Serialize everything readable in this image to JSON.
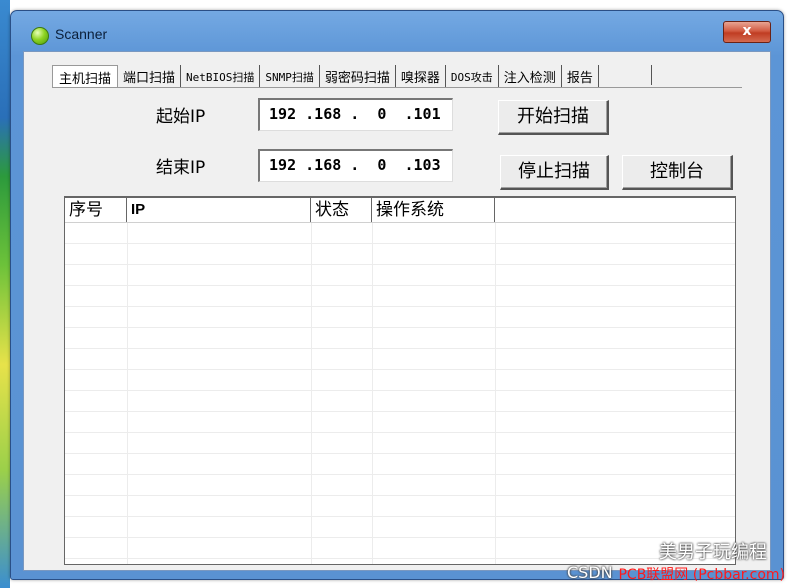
{
  "window": {
    "title": "Scanner",
    "close_label": "x"
  },
  "tabs": [
    {
      "label": "主机扫描",
      "active": true
    },
    {
      "label": "端口扫描"
    },
    {
      "label": "NetBIOS扫描"
    },
    {
      "label": "SNMP扫描"
    },
    {
      "label": "弱密码扫描"
    },
    {
      "label": "嗅探器"
    },
    {
      "label": "DOS攻击"
    },
    {
      "label": "注入检测"
    },
    {
      "label": "报告"
    },
    {
      "label": ""
    }
  ],
  "form": {
    "start_ip_label": "起始IP",
    "start_ip_value": " 192 .168 .  0  .101",
    "end_ip_label": "结束IP",
    "end_ip_value": " 192 .168 .  0  .103"
  },
  "buttons": {
    "start_scan": "开始扫描",
    "stop_scan": "停止扫描",
    "console": "控制台"
  },
  "table": {
    "columns": [
      "序号",
      "IP",
      "状态",
      "操作系统",
      ""
    ],
    "rows": []
  },
  "watermark": {
    "text": "美男子玩编程",
    "source": "CSDN",
    "site": "PCB联盟网 (Pcbbar.com)"
  }
}
